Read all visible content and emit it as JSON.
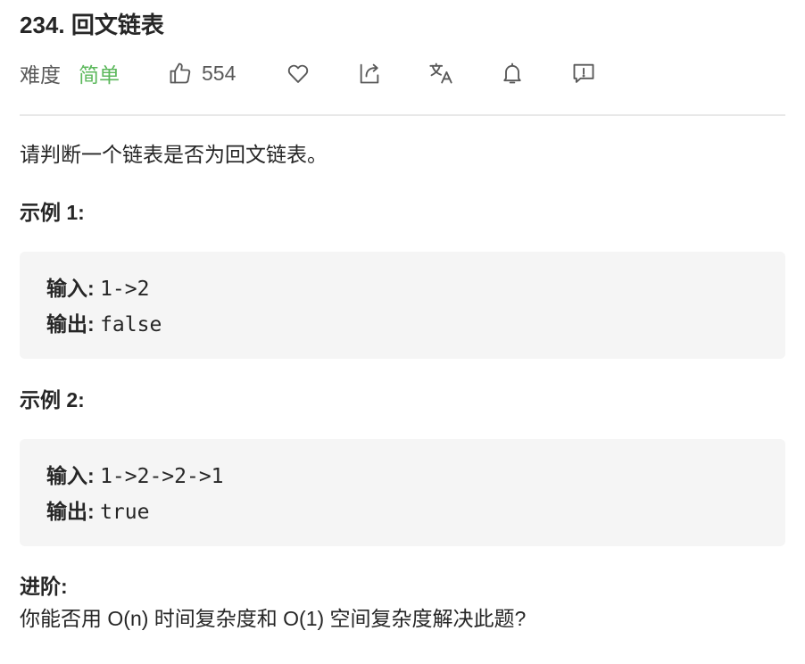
{
  "problem": {
    "title": "234. 回文链表",
    "difficulty_label": "难度",
    "difficulty_value": "简单",
    "likes": "554"
  },
  "toolbar": {
    "icons": [
      "thumbs-up-icon",
      "heart-icon",
      "share-icon",
      "translate-icon",
      "bell-icon",
      "feedback-icon"
    ]
  },
  "description": "请判断一个链表是否为回文链表。",
  "examples": [
    {
      "heading": "示例 1:",
      "input_label": "输入:",
      "input_value": "1->2",
      "output_label": "输出:",
      "output_value": "false"
    },
    {
      "heading": "示例 2:",
      "input_label": "输入:",
      "input_value": "1->2->2->1",
      "output_label": "输出:",
      "output_value": "true"
    }
  ],
  "advanced": {
    "heading": "进阶:",
    "text": "你能否用 O(n) 时间复杂度和 O(1) 空间复杂度解决此题?"
  },
  "colors": {
    "difficulty_easy": "#5cb85c",
    "text": "#262626",
    "muted": "#595959",
    "code_bg": "#f5f5f5",
    "divider": "#e8e8e8"
  }
}
